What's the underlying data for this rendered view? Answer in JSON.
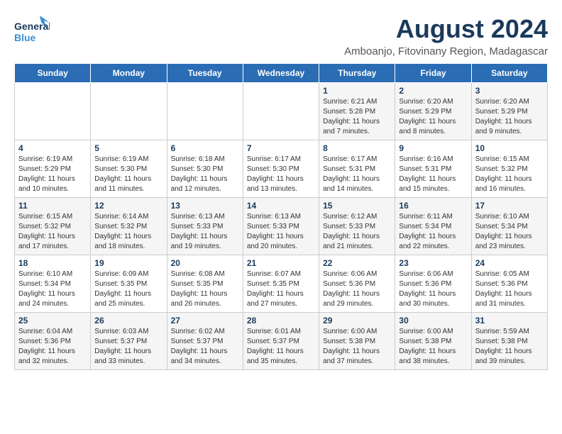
{
  "header": {
    "logo_general": "General",
    "logo_blue": "Blue",
    "main_title": "August 2024",
    "subtitle": "Amboanjo, Fitovinany Region, Madagascar"
  },
  "days_of_week": [
    "Sunday",
    "Monday",
    "Tuesday",
    "Wednesday",
    "Thursday",
    "Friday",
    "Saturday"
  ],
  "weeks": [
    [
      {
        "day": "",
        "info": ""
      },
      {
        "day": "",
        "info": ""
      },
      {
        "day": "",
        "info": ""
      },
      {
        "day": "",
        "info": ""
      },
      {
        "day": "1",
        "info": "Sunrise: 6:21 AM\nSunset: 5:28 PM\nDaylight: 11 hours\nand 7 minutes."
      },
      {
        "day": "2",
        "info": "Sunrise: 6:20 AM\nSunset: 5:29 PM\nDaylight: 11 hours\nand 8 minutes."
      },
      {
        "day": "3",
        "info": "Sunrise: 6:20 AM\nSunset: 5:29 PM\nDaylight: 11 hours\nand 9 minutes."
      }
    ],
    [
      {
        "day": "4",
        "info": "Sunrise: 6:19 AM\nSunset: 5:29 PM\nDaylight: 11 hours\nand 10 minutes."
      },
      {
        "day": "5",
        "info": "Sunrise: 6:19 AM\nSunset: 5:30 PM\nDaylight: 11 hours\nand 11 minutes."
      },
      {
        "day": "6",
        "info": "Sunrise: 6:18 AM\nSunset: 5:30 PM\nDaylight: 11 hours\nand 12 minutes."
      },
      {
        "day": "7",
        "info": "Sunrise: 6:17 AM\nSunset: 5:30 PM\nDaylight: 11 hours\nand 13 minutes."
      },
      {
        "day": "8",
        "info": "Sunrise: 6:17 AM\nSunset: 5:31 PM\nDaylight: 11 hours\nand 14 minutes."
      },
      {
        "day": "9",
        "info": "Sunrise: 6:16 AM\nSunset: 5:31 PM\nDaylight: 11 hours\nand 15 minutes."
      },
      {
        "day": "10",
        "info": "Sunrise: 6:15 AM\nSunset: 5:32 PM\nDaylight: 11 hours\nand 16 minutes."
      }
    ],
    [
      {
        "day": "11",
        "info": "Sunrise: 6:15 AM\nSunset: 5:32 PM\nDaylight: 11 hours\nand 17 minutes."
      },
      {
        "day": "12",
        "info": "Sunrise: 6:14 AM\nSunset: 5:32 PM\nDaylight: 11 hours\nand 18 minutes."
      },
      {
        "day": "13",
        "info": "Sunrise: 6:13 AM\nSunset: 5:33 PM\nDaylight: 11 hours\nand 19 minutes."
      },
      {
        "day": "14",
        "info": "Sunrise: 6:13 AM\nSunset: 5:33 PM\nDaylight: 11 hours\nand 20 minutes."
      },
      {
        "day": "15",
        "info": "Sunrise: 6:12 AM\nSunset: 5:33 PM\nDaylight: 11 hours\nand 21 minutes."
      },
      {
        "day": "16",
        "info": "Sunrise: 6:11 AM\nSunset: 5:34 PM\nDaylight: 11 hours\nand 22 minutes."
      },
      {
        "day": "17",
        "info": "Sunrise: 6:10 AM\nSunset: 5:34 PM\nDaylight: 11 hours\nand 23 minutes."
      }
    ],
    [
      {
        "day": "18",
        "info": "Sunrise: 6:10 AM\nSunset: 5:34 PM\nDaylight: 11 hours\nand 24 minutes."
      },
      {
        "day": "19",
        "info": "Sunrise: 6:09 AM\nSunset: 5:35 PM\nDaylight: 11 hours\nand 25 minutes."
      },
      {
        "day": "20",
        "info": "Sunrise: 6:08 AM\nSunset: 5:35 PM\nDaylight: 11 hours\nand 26 minutes."
      },
      {
        "day": "21",
        "info": "Sunrise: 6:07 AM\nSunset: 5:35 PM\nDaylight: 11 hours\nand 27 minutes."
      },
      {
        "day": "22",
        "info": "Sunrise: 6:06 AM\nSunset: 5:36 PM\nDaylight: 11 hours\nand 29 minutes."
      },
      {
        "day": "23",
        "info": "Sunrise: 6:06 AM\nSunset: 5:36 PM\nDaylight: 11 hours\nand 30 minutes."
      },
      {
        "day": "24",
        "info": "Sunrise: 6:05 AM\nSunset: 5:36 PM\nDaylight: 11 hours\nand 31 minutes."
      }
    ],
    [
      {
        "day": "25",
        "info": "Sunrise: 6:04 AM\nSunset: 5:36 PM\nDaylight: 11 hours\nand 32 minutes."
      },
      {
        "day": "26",
        "info": "Sunrise: 6:03 AM\nSunset: 5:37 PM\nDaylight: 11 hours\nand 33 minutes."
      },
      {
        "day": "27",
        "info": "Sunrise: 6:02 AM\nSunset: 5:37 PM\nDaylight: 11 hours\nand 34 minutes."
      },
      {
        "day": "28",
        "info": "Sunrise: 6:01 AM\nSunset: 5:37 PM\nDaylight: 11 hours\nand 35 minutes."
      },
      {
        "day": "29",
        "info": "Sunrise: 6:00 AM\nSunset: 5:38 PM\nDaylight: 11 hours\nand 37 minutes."
      },
      {
        "day": "30",
        "info": "Sunrise: 6:00 AM\nSunset: 5:38 PM\nDaylight: 11 hours\nand 38 minutes."
      },
      {
        "day": "31",
        "info": "Sunrise: 5:59 AM\nSunset: 5:38 PM\nDaylight: 11 hours\nand 39 minutes."
      }
    ]
  ]
}
